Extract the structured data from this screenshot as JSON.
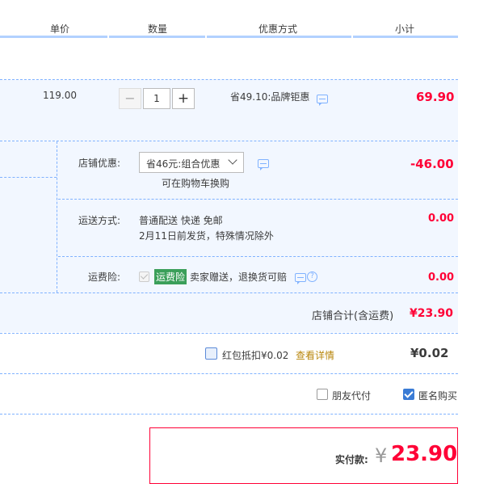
{
  "header": {
    "unit_price": "单价",
    "quantity": "数量",
    "promotion": "优惠方式",
    "subtotal": "小计"
  },
  "item": {
    "price": "119.00",
    "minus": "−",
    "qty": "1",
    "plus": "+",
    "promo": "省49.10:品牌钜惠",
    "subtotal": "69.90"
  },
  "shop_discount": {
    "label": "店铺优惠:",
    "select_value": "省46元:组合优惠",
    "hint": "可在购物车换购",
    "amount": "-46.00"
  },
  "shipping": {
    "label": "运送方式:",
    "line1": "普通配送 快递 免邮",
    "line2": "2月11日前发货，特殊情况除外",
    "amount": "0.00"
  },
  "insurance": {
    "label": "运费险:",
    "badge": "运费险",
    "text": "卖家赠送，退换货可赔",
    "amount": "0.00"
  },
  "shop_total": {
    "label": "店铺合计(含运费)",
    "amount": "¥23.90"
  },
  "redpacket": {
    "label": "红包抵扣¥0.02",
    "link": "查看详情",
    "amount": "¥0.02"
  },
  "options": {
    "friend_pay": "朋友代付",
    "anonymous": "匿名购买"
  },
  "pay": {
    "label": "实付款:",
    "currency": "¥",
    "amount": "23.90"
  },
  "colors": {
    "accent_red": "#ff0036",
    "header_bar": "#b2d1ff",
    "panel_blue": "#f2f7ff",
    "checkbox_blue": "#3a7bd5",
    "badge_green": "#3b9f5a"
  }
}
